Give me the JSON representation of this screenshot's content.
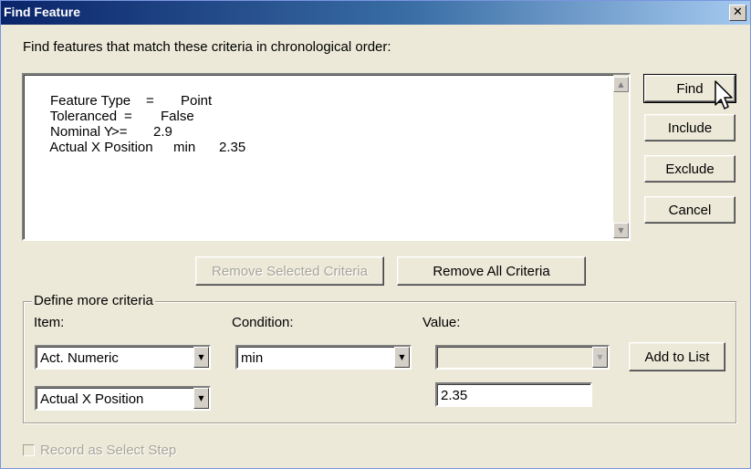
{
  "window": {
    "title": "Find Feature",
    "close_glyph": "✕"
  },
  "instruction": "Find features that match these criteria in chronological order:",
  "criteria": [
    {
      "c1": "Feature Type",
      "c2": "=",
      "c3": "Point"
    },
    {
      "c1": "Toleranced",
      "c2": "=",
      "c3": "False"
    },
    {
      "c1": "Nominal Y",
      "c2": ">=",
      "c3": "2.9"
    },
    {
      "c1": "Actual X Position",
      "c2": "min",
      "c3": "2.35"
    }
  ],
  "side_buttons": {
    "find": "Find",
    "include": "Include",
    "exclude": "Exclude",
    "cancel": "Cancel"
  },
  "criteria_buttons": {
    "remove_selected": "Remove Selected Criteria",
    "remove_all": "Remove All Criteria"
  },
  "define": {
    "legend": "Define more criteria",
    "item_label": "Item:",
    "condition_label": "Condition:",
    "value_label": "Value:",
    "item_type": "Act. Numeric",
    "item_name": "Actual X Position",
    "condition": "min",
    "value_combo": "",
    "value_text": "2.35",
    "add_to_list": "Add to List"
  },
  "record_step": {
    "label": "Record as Select Step",
    "checked": false,
    "enabled": false
  },
  "icons": {
    "scroll_up": "arrow-up-icon",
    "scroll_down": "arrow-down-icon",
    "dropdown": "chevron-down-icon",
    "cursor": "mouse-pointer-icon"
  }
}
